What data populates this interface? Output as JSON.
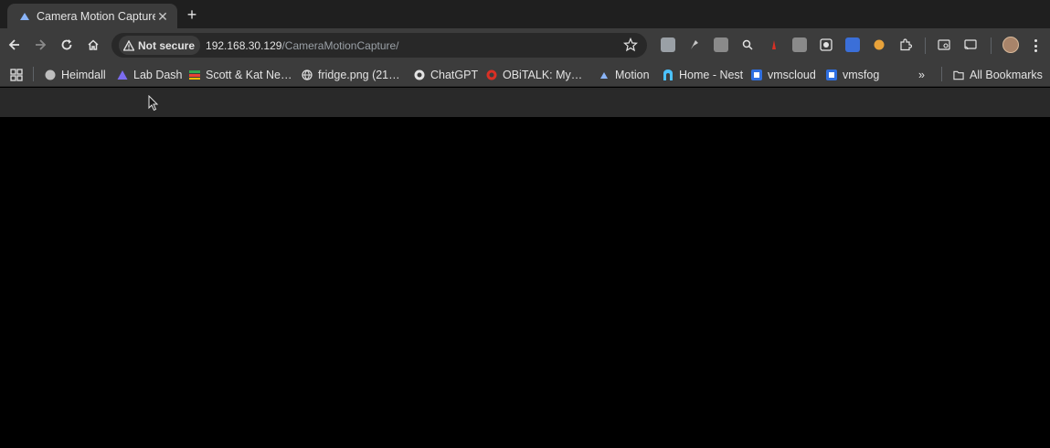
{
  "tab": {
    "title": "Camera Motion Capture",
    "close": "✕",
    "new_tab": "+"
  },
  "address_bar": {
    "security_label": "Not secure",
    "url_host": "192.168.30.129",
    "url_path": "/CameraMotionCapture/"
  },
  "bookmarks": [
    {
      "label": "Heimdall",
      "icon": "heimdall-icon"
    },
    {
      "label": "Lab Dash",
      "icon": "triangle-icon"
    },
    {
      "label": "Scott & Kat Ne…",
      "icon": "list-icon"
    },
    {
      "label": "fridge.png (21…",
      "icon": "globe-icon"
    },
    {
      "label": "ChatGPT",
      "icon": "chatgpt-icon"
    },
    {
      "label": "OBiTALK: My…",
      "icon": "obitalk-icon"
    },
    {
      "label": "Motion",
      "icon": "motion-icon"
    },
    {
      "label": "Home - Nest",
      "icon": "nest-icon"
    },
    {
      "label": "vmscloud",
      "icon": "vms-icon"
    },
    {
      "label": "vmsfog",
      "icon": "vms-icon"
    }
  ],
  "bookmarks_overflow": "»",
  "all_bookmarks": "All Bookmarks",
  "colors": {
    "tabstrip": "#1f1f1f",
    "toolbar": "#3c3c3c",
    "page_header": "#292929",
    "page_body": "#000000"
  }
}
